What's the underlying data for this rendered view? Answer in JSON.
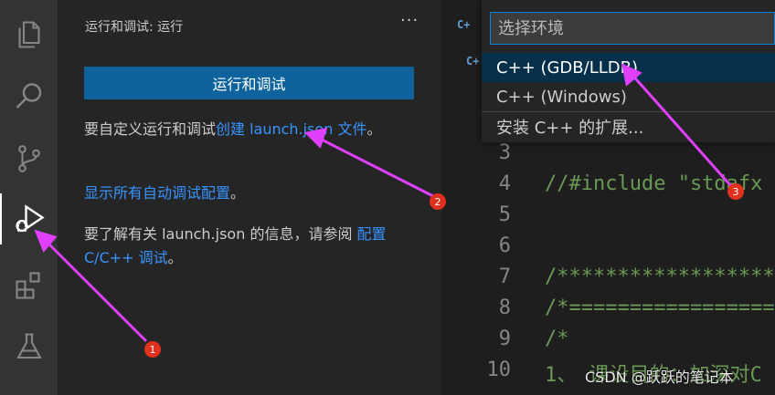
{
  "activity_bar": {
    "items": [
      {
        "icon": "files-icon"
      },
      {
        "icon": "search-icon"
      },
      {
        "icon": "source-control-icon"
      },
      {
        "icon": "run-debug-icon",
        "active": true
      },
      {
        "icon": "extensions-icon"
      },
      {
        "icon": "testing-icon"
      }
    ]
  },
  "sidebar": {
    "title": "运行和调试: 运行",
    "more": "···",
    "run_button": "运行和调试",
    "custom_prefix": "要自定义运行和调试",
    "custom_link": "创建 launch.json 文件",
    "custom_suffix": "。",
    "show_all_link": "显示所有自动调试配置",
    "show_all_suffix": "。",
    "learn_prefix": "要了解有关 launch.json 的信息，请参阅",
    "learn_link": "配置 C/C++ 调试",
    "learn_suffix": "。"
  },
  "editor": {
    "tab_icon": "C+",
    "lines": [
      {
        "num": "3",
        "code": ""
      },
      {
        "num": "4",
        "code": "//#include \"stdafx"
      },
      {
        "num": "5",
        "code": ""
      },
      {
        "num": "6",
        "code": ""
      },
      {
        "num": "7",
        "code": "/******************"
      },
      {
        "num": "8",
        "code": "/*==================="
      },
      {
        "num": "9",
        "code": "/*"
      },
      {
        "num": "10",
        "code": "1、 课设目的：加深对C"
      }
    ]
  },
  "quick_pick": {
    "placeholder": "选择环境",
    "items": [
      {
        "label": "C++ (GDB/LLDB)",
        "selected": true
      },
      {
        "label": "C++ (Windows)",
        "selected": false
      },
      {
        "label": "安装 C++ 的扩展...",
        "selected": false
      }
    ]
  },
  "annotations": {
    "badges": [
      "1",
      "2",
      "3"
    ],
    "color": "#e040fb"
  },
  "watermark": "CSDN @跃跃的笔记本"
}
